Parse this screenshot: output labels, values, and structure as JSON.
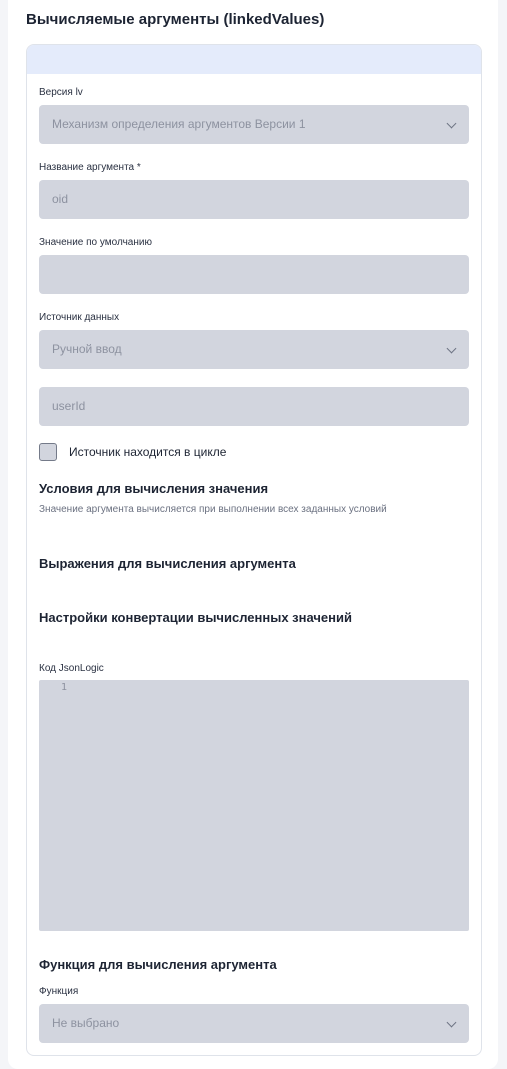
{
  "page": {
    "title": "Вычисляемые аргументы (linkedValues)"
  },
  "form": {
    "version": {
      "label": "Версия lv",
      "value": "Механизм определения аргументов Версии 1"
    },
    "arg_name": {
      "label": "Название аргумента *",
      "value": "oid"
    },
    "default_value": {
      "label": "Значение по умолчанию",
      "value": ""
    },
    "data_source": {
      "label": "Источник данных",
      "value": "Ручной ввод"
    },
    "source_value": {
      "value": "userId"
    },
    "loop_checkbox": {
      "label": "Источник находится в цикле",
      "checked": false
    },
    "conditions": {
      "title": "Условия для вычисления значения",
      "hint": "Значение аргумента вычисляется при выполнении всех заданных условий"
    },
    "expressions": {
      "title": "Выражения для вычисления аргумента"
    },
    "conversion": {
      "title": "Настройки конвертации вычисленных значений"
    },
    "jsonlogic": {
      "label": "Код JsonLogic",
      "line_number": "1"
    },
    "function_section": {
      "title": "Функция для вычисления аргумента"
    },
    "function": {
      "label": "Функция",
      "value": "Не выбрано"
    }
  },
  "icons": {
    "dropdown": "chevron-down-icon",
    "checkbox": "checkbox-unchecked"
  },
  "colors": {
    "header_band": "#e4ebfb",
    "field_bg": "#d2d5de",
    "text": "#1d2433"
  }
}
